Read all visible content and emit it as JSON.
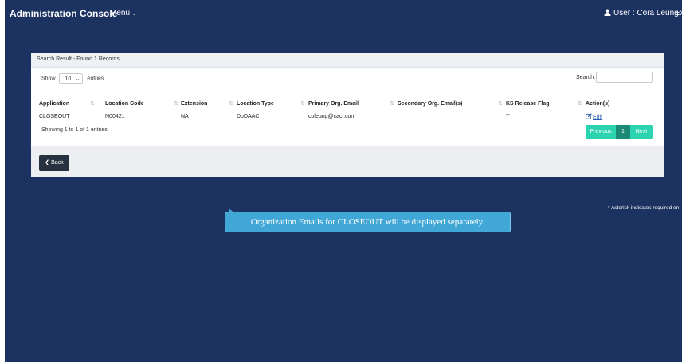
{
  "header": {
    "title": "Administration Console",
    "menu_label": "Menu",
    "user_label": "User : Cora Leung",
    "exit_label": "Ex"
  },
  "panel": {
    "heading": "Search Result - Found 1 Records",
    "show_prefix": "Show",
    "page_size": "10",
    "show_suffix": "entries",
    "search_label": "Search:",
    "search_value": "",
    "columns": [
      "Application",
      "Location Code",
      "Extension",
      "Location Type",
      "Primary Org. Email",
      "Secondary Org. Email(s)",
      "KS Release Flag",
      "Action(s)"
    ],
    "rows": [
      {
        "application": "CLOSEOUT",
        "location_code": "N00421",
        "extension": "NA",
        "location_type": "DoDAAC",
        "primary_email": "coleung@caci.com",
        "secondary_email": "",
        "ks_release_flag": "Y",
        "action": "Edit"
      }
    ],
    "info": "Showing 1 to 1 of 1 entries",
    "pagination": {
      "previous": "Previous",
      "current": "1",
      "next": "Next"
    },
    "back_label": "Back"
  },
  "note": "* Asterisk indicates required en",
  "tooltip": "Organization Emails for CLOSEOUT will be displayed separately.",
  "colors": {
    "background": "#1c3260",
    "pager": "#2ad4b0",
    "pager_active": "#1a8a74",
    "tooltip": "#41a7d6"
  }
}
